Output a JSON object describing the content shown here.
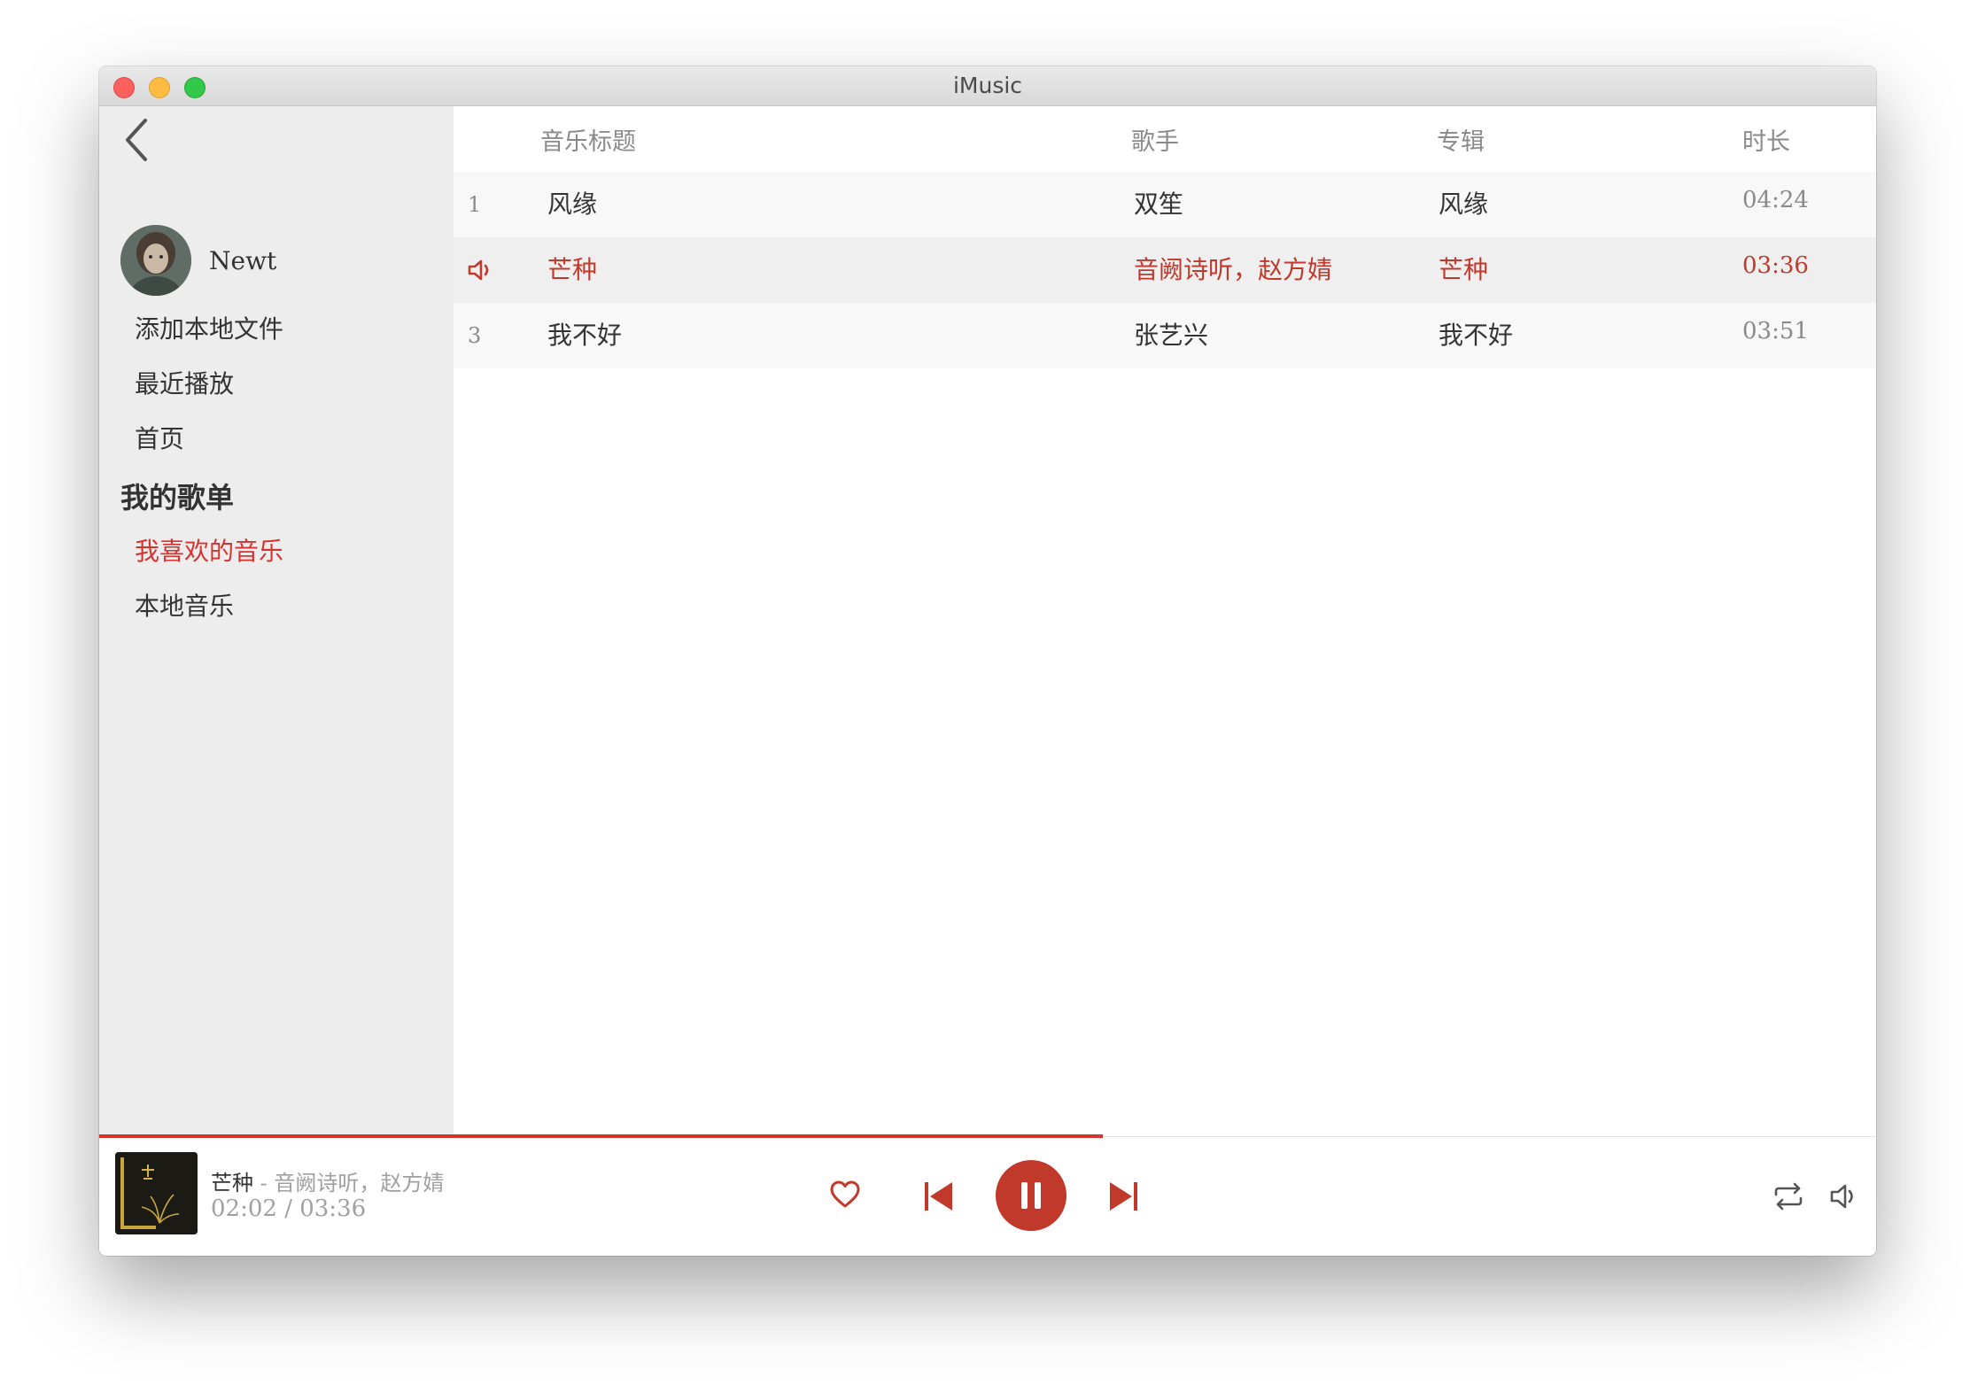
{
  "window": {
    "title": "iMusic"
  },
  "sidebar": {
    "username": "Newt",
    "nav": [
      {
        "label": "添加本地文件"
      },
      {
        "label": "最近播放"
      },
      {
        "label": "首页"
      }
    ],
    "playlist_section_title": "我的歌单",
    "playlists": [
      {
        "label": "我喜欢的音乐",
        "active": true
      },
      {
        "label": "本地音乐",
        "active": false
      }
    ]
  },
  "table": {
    "headers": {
      "title": "音乐标题",
      "artist": "歌手",
      "album": "专辑",
      "duration": "时长"
    },
    "rows": [
      {
        "index": "1",
        "title": "风缘",
        "artist": "双笙",
        "album": "风缘",
        "duration": "04:24",
        "playing": false
      },
      {
        "index": "",
        "title": "芒种",
        "artist": "音阙诗听，赵方婧",
        "album": "芒种",
        "duration": "03:36",
        "playing": true
      },
      {
        "index": "3",
        "title": "我不好",
        "artist": "张艺兴",
        "album": "我不好",
        "duration": "03:51",
        "playing": false
      }
    ]
  },
  "player": {
    "title": "芒种",
    "artist_suffix": " - 音阙诗听，赵方婧",
    "time": "02:02 / 03:36",
    "progress": 0.565,
    "accent_color": "#c0392b",
    "progress_color": "#d6332f",
    "icons": [
      "heart-icon",
      "previous-icon",
      "pause-icon",
      "next-icon",
      "repeat-icon",
      "volume-icon"
    ]
  }
}
